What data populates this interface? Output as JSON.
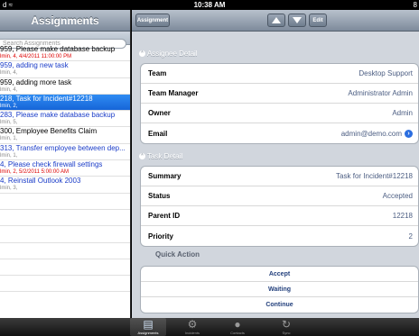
{
  "statusbar": {
    "carrier": "d ≈",
    "time": "10:38 AM",
    "battery": "8"
  },
  "master": {
    "title": "Assignments",
    "search_placeholder": "Search Assignments",
    "items": [
      {
        "line1": "959, Please make database backup",
        "line2": "lmin, 4, 4/4/2011 11:00:00 PM",
        "style": "overdue"
      },
      {
        "line1": "959, adding new task",
        "line2": "lmin, 4,",
        "style": "blue"
      },
      {
        "line1": "959, adding more task",
        "line2": "lmin, 4,",
        "style": "plain"
      },
      {
        "line1": "218, Task for Incident#12218",
        "line2": "lmin, 2,",
        "style": "selected"
      },
      {
        "line1": "283, Please make database backup",
        "line2": "lmin, 5,",
        "style": "blue"
      },
      {
        "line1": "300, Employee Benefits Claim",
        "line2": "lmin, 1,",
        "style": "plain"
      },
      {
        "line1": "313, Transfer employee between dep...",
        "line2": "lmin, 1,",
        "style": "blue"
      },
      {
        "line1": "4, Please check  firewall settings",
        "line2": "lmin, 2, 5/2/2011 5:00:00 AM",
        "style": "overdue-blue"
      },
      {
        "line1": "4, Reinstall Outlook 2003",
        "line2": "lmin, 3,",
        "style": "blue"
      }
    ]
  },
  "toolbar": {
    "assignment_label": "Assignment",
    "edit_label": "Edit"
  },
  "assignee": {
    "section_label": "Assignee Detail",
    "rows": [
      {
        "label": "Team",
        "value": "Desktop Support"
      },
      {
        "label": "Team Manager",
        "value": "Administrator Admin"
      },
      {
        "label": "Owner",
        "value": "Admin"
      },
      {
        "label": "Email",
        "value": "admin@demo.com"
      }
    ]
  },
  "task": {
    "section_label": "Task Detail",
    "rows": [
      {
        "label": "Summary",
        "value": "Task for Incident#12218"
      },
      {
        "label": "Status",
        "value": "Accepted"
      },
      {
        "label": "Parent ID",
        "value": "12218"
      },
      {
        "label": "Priority",
        "value": "2"
      }
    ]
  },
  "quick_action": {
    "label": "Quick Action",
    "actions": [
      "Accept",
      "Waiting",
      "Continue"
    ]
  },
  "tabbar": {
    "tabs": [
      {
        "label": "Assignments",
        "icon": "assignments-icon",
        "active": true
      },
      {
        "label": "Incidents",
        "icon": "gears-icon",
        "active": false
      },
      {
        "label": "Contacts",
        "icon": "person-icon",
        "active": false
      },
      {
        "label": "Sync",
        "icon": "sync-icon",
        "active": false
      }
    ]
  }
}
